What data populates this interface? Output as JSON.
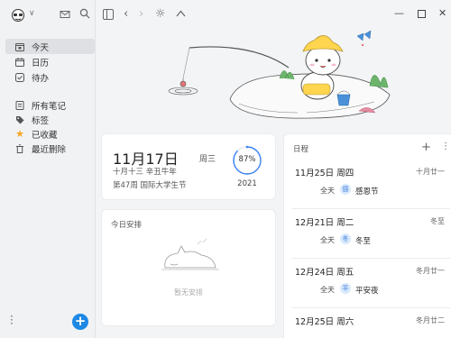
{
  "sidebar": {
    "items": [
      {
        "label": "今天",
        "icon": "calendar-today-icon"
      },
      {
        "label": "日历",
        "icon": "calendar-icon"
      },
      {
        "label": "待办",
        "icon": "checkbox-icon"
      },
      {
        "label": "所有笔记",
        "icon": "note-icon"
      },
      {
        "label": "标签",
        "icon": "tag-icon"
      },
      {
        "label": "已收藏",
        "icon": "star-icon"
      },
      {
        "label": "最近删除",
        "icon": "trash-icon"
      }
    ]
  },
  "date_card": {
    "date": "11月17日",
    "weekday": "周三",
    "lunar": "十月十三  辛丑牛年",
    "week": "第47周 国际大学生节",
    "progress": "87%",
    "progress_value": 0.87,
    "year": "2021"
  },
  "today_card": {
    "title": "今日安排",
    "empty": "暂无安排"
  },
  "calendar": {
    "title": "日程",
    "events": [
      {
        "date": "11月25日  周四",
        "lunar": "十月廿一",
        "allday": "全天",
        "badge": "感",
        "name": "感恩节"
      },
      {
        "date": "12月21日  周二",
        "lunar": "冬至",
        "allday": "全天",
        "badge": "冬",
        "name": "冬至"
      },
      {
        "date": "12月24日  周五",
        "lunar": "冬月廿一",
        "allday": "全天",
        "badge": "平",
        "name": "平安夜"
      },
      {
        "date": "12月25日  周六",
        "lunar": "冬月廿二"
      }
    ]
  },
  "colors": {
    "accent": "#1e88e5",
    "ring": "#3b82f6"
  }
}
